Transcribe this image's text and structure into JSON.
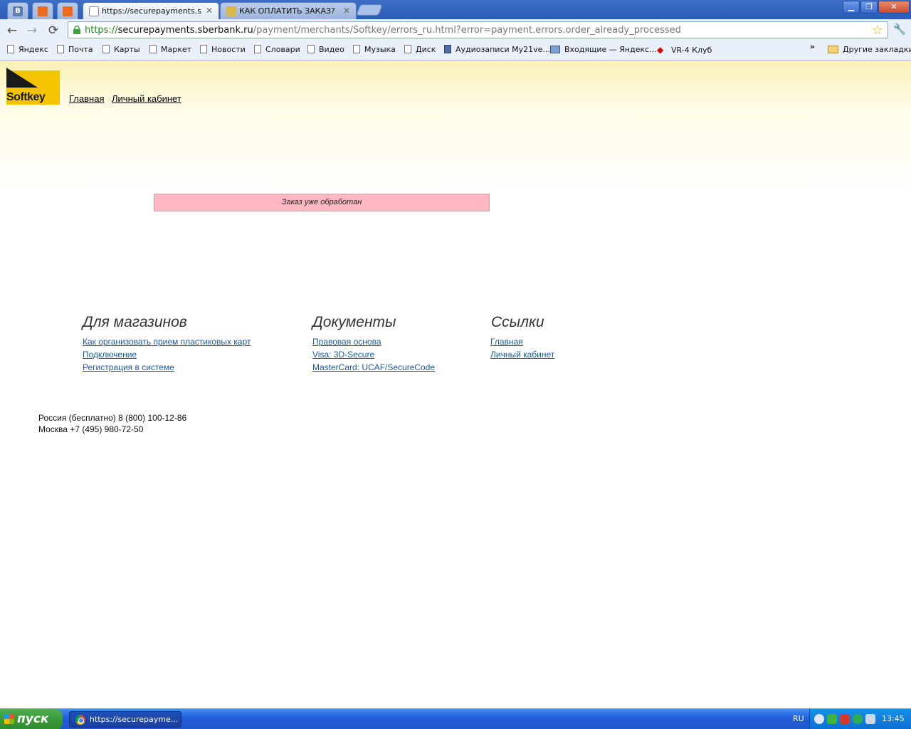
{
  "browser": {
    "tabs": [
      {
        "title": "",
        "icon": "vk-icon",
        "pinned": true,
        "favicon_letter": "B"
      },
      {
        "title": "",
        "icon": "music-orange-icon",
        "pinned": true
      },
      {
        "title": "",
        "icon": "music-orange-icon",
        "pinned": true
      },
      {
        "title": "https://securepayments.sber",
        "icon": "page-icon",
        "active": true
      },
      {
        "title": "КАК ОПЛАТИТЬ ЗАКАЗ?",
        "icon": "money-icon"
      }
    ],
    "url_scheme": "https://",
    "url_host": "securepayments.sberbank.ru",
    "url_path": "/payment/merchants/Softkey/errors_ru.html?error=payment.errors.order_already_processed",
    "bookmarks": [
      "Яндекс",
      "Почта",
      "Карты",
      "Маркет",
      "Новости",
      "Словари",
      "Видео",
      "Музыка",
      "Диск",
      "Аудиозаписи My21ve...",
      "Входящие — Яндекс...",
      "VR-4 Клуб"
    ],
    "bookmarks_overflow": "»",
    "other_bookmarks": "Другие закладки"
  },
  "page": {
    "logo_text": "Softkey",
    "header_links": [
      "Главная",
      "Личный кабинет"
    ],
    "error_message": "Заказ уже обработан",
    "columns": [
      {
        "title": "Для магазинов",
        "links": [
          "Как организовать прием пластиковых карт",
          "Подключение",
          "Регистрация в системе"
        ]
      },
      {
        "title": "Документы",
        "links": [
          "Правовая основа",
          "Visa: 3D-Secure",
          "MasterCard: UCAF/SecureCode"
        ]
      },
      {
        "title": "Ссылки",
        "links": [
          "Главная",
          "Личный кабинет"
        ]
      }
    ],
    "phones": [
      "Россия (бесплатно) 8 (800) 100-12-86",
      "Москва +7 (495) 980-72-50"
    ]
  },
  "taskbar": {
    "start_label": "пуск",
    "task_label": "https://securepayme...",
    "language": "RU",
    "time": "13:45"
  },
  "colors": {
    "error_bg": "#ffb7c4",
    "link": "#1c5aa6",
    "logo_yellow": "#f5c400"
  }
}
